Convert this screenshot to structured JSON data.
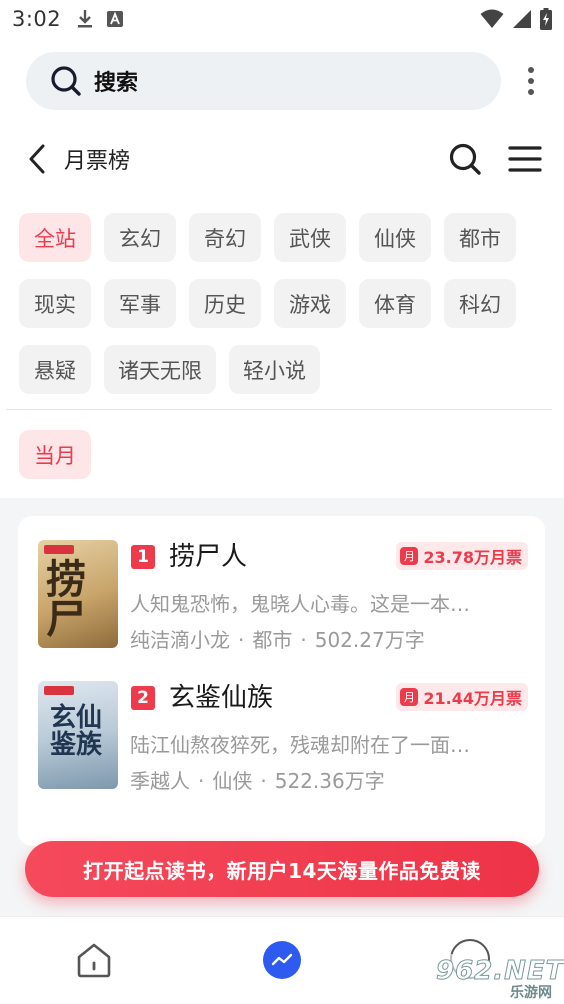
{
  "status_bar": {
    "time": "3:02",
    "icons_left": [
      "download-icon",
      "a-box-icon"
    ],
    "icons_right": [
      "wifi-icon",
      "signal-icon",
      "battery-charging-icon"
    ]
  },
  "search": {
    "label": "搜索"
  },
  "header": {
    "title": "月票榜"
  },
  "categories": [
    "全站",
    "玄幻",
    "奇幻",
    "武侠",
    "仙侠",
    "都市",
    "现实",
    "军事",
    "历史",
    "游戏",
    "体育",
    "科幻",
    "悬疑",
    "诸天无限",
    "轻小说"
  ],
  "active_category": "全站",
  "periods": [
    "当月"
  ],
  "active_period": "当月",
  "books": [
    {
      "rank": "1",
      "title": "捞尸人",
      "tickets": "23.78万月票",
      "description": "人知鬼恐怖，鬼晓人心毒。这是一本…",
      "author": "纯洁滴小龙",
      "category": "都市",
      "word_count": "502.27万字"
    },
    {
      "rank": "2",
      "title": "玄鉴仙族",
      "tickets": "21.44万月票",
      "description": "陆江仙熬夜猝死，残魂却附在了一面…",
      "author": "季越人",
      "category": "仙侠",
      "word_count": "522.36万字"
    }
  ],
  "meta_separator": "·",
  "promo": {
    "text": "打开起点读书，新用户14天海量作品免费读"
  },
  "bottom_nav": {
    "items": [
      "home-icon",
      "discover-icon",
      "profile-icon"
    ]
  },
  "watermark": {
    "brand": "962.NET",
    "sub": "乐游网"
  },
  "colors": {
    "accent": "#ed3b4c",
    "chip_active_bg": "#fde5e8",
    "chip_bg": "#f2f2f2",
    "search_bg": "#eef1f4",
    "nav_center": "#2e5bef"
  }
}
